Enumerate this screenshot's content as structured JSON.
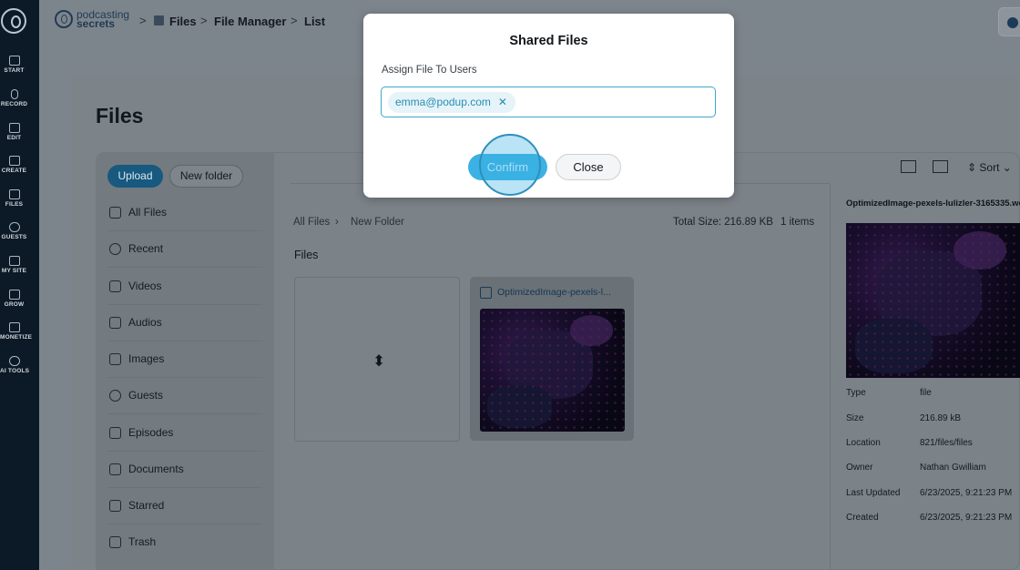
{
  "nav": {
    "items": [
      {
        "label": "START",
        "icon": "start-icon"
      },
      {
        "label": "RECORD",
        "icon": "mic-icon"
      },
      {
        "label": "EDIT",
        "icon": "edit-icon"
      },
      {
        "label": "CREATE",
        "icon": "create-icon"
      },
      {
        "label": "FILES",
        "icon": "files-icon"
      },
      {
        "label": "GUESTS",
        "icon": "guests-icon"
      },
      {
        "label": "MY SITE",
        "icon": "site-icon"
      },
      {
        "label": "GROW",
        "icon": "grow-icon"
      },
      {
        "label": "MONETIZE",
        "icon": "monetize-icon"
      },
      {
        "label": "AI TOOLS",
        "icon": "ai-tools-icon"
      }
    ]
  },
  "brand": {
    "line1": "podcasting",
    "line2": "secrets"
  },
  "breadcrumb": {
    "items": [
      "Files",
      "File Manager",
      "List"
    ],
    "separator": ">"
  },
  "page": {
    "title": "Files"
  },
  "sidebar": {
    "upload_label": "Upload",
    "new_folder_label": "New folder",
    "items": [
      "All Files",
      "Recent",
      "Videos",
      "Audios",
      "Images",
      "Guests",
      "Episodes",
      "Documents",
      "Starred",
      "Trash"
    ]
  },
  "toolbar": {
    "sort_label": "Sort"
  },
  "location": {
    "path": [
      "All Files",
      "New Folder"
    ],
    "total_size": "Total Size: 216.89 KB",
    "item_count": "1 items"
  },
  "files": {
    "section_label": "Files",
    "upload_tile_icon": "⬍",
    "file_name": "OptimizedImage-pexels-l..."
  },
  "details": {
    "file_name": "OptimizedImage-pexels-lulizler-3165335.we",
    "rows": [
      {
        "key": "Type",
        "value": "file"
      },
      {
        "key": "Size",
        "value": "216.89 kB"
      },
      {
        "key": "Location",
        "value": "821/files/files"
      },
      {
        "key": "Owner",
        "value": "Nathan Gwilliam"
      },
      {
        "key": "Last Updated",
        "value": "6/23/2025, 9:21:23 PM"
      },
      {
        "key": "Created",
        "value": "6/23/2025, 9:21:23 PM"
      }
    ]
  },
  "modal": {
    "title": "Shared Files",
    "assign_label": "Assign File To Users",
    "chip_email": "emma@podup.com",
    "chip_remove": "✕",
    "confirm_label": "Confirm",
    "close_label": "Close"
  },
  "colors": {
    "accent": "#3bb2e3",
    "nav_bg": "#0c1a27",
    "chip_text": "#278eb3"
  }
}
